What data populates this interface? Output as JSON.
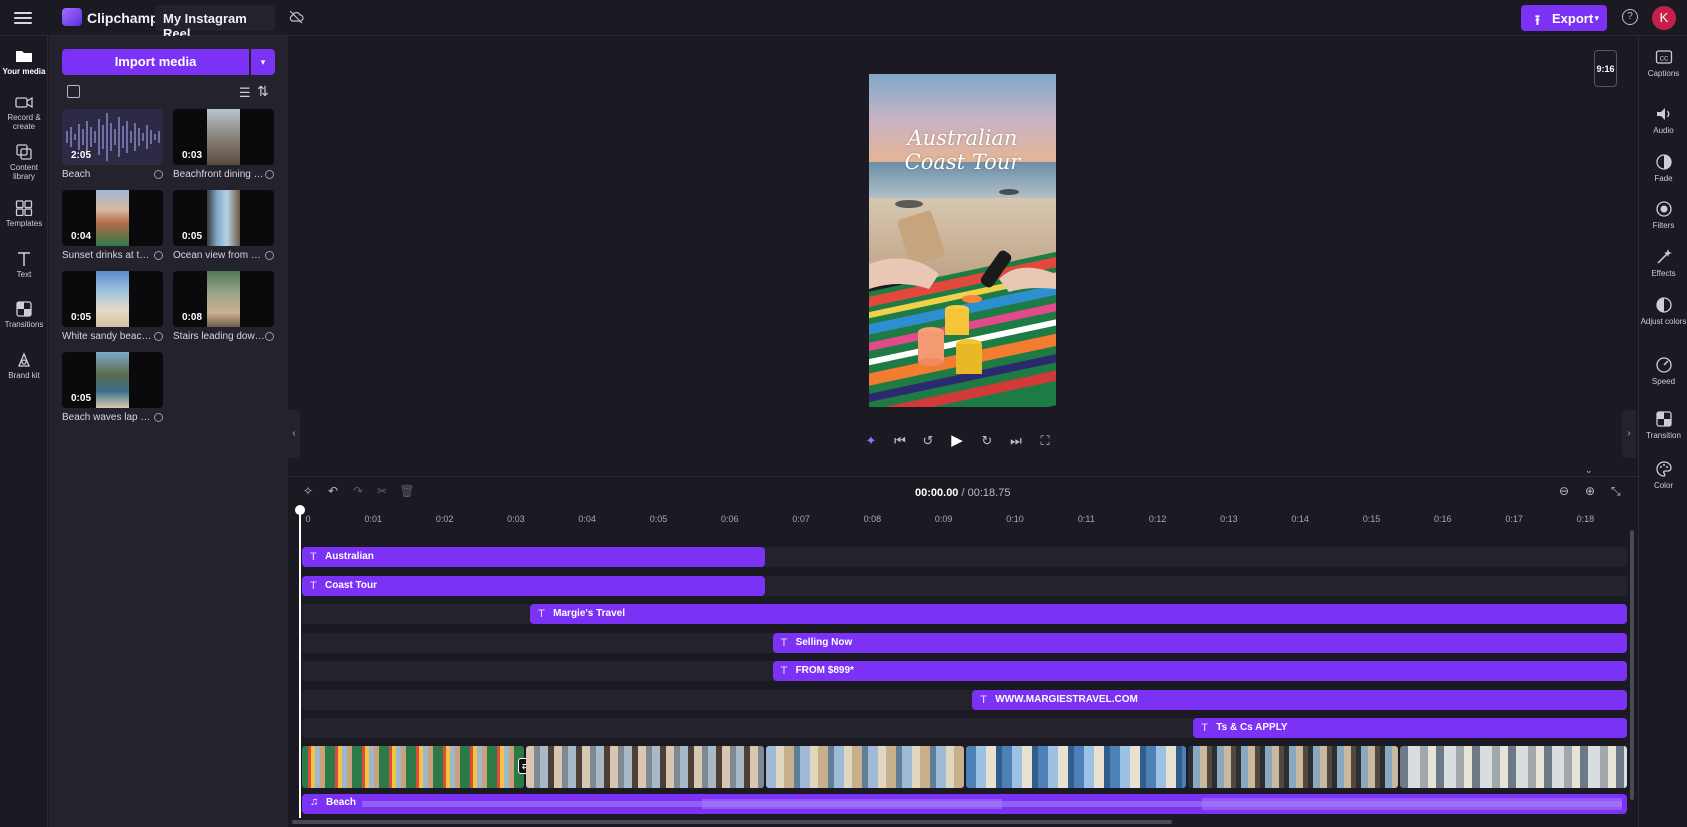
{
  "topbar": {
    "app_name": "Clipchamp",
    "project_name": "My Instagram Reel",
    "export_label": "Export",
    "avatar_initial": "K",
    "help_label": "?"
  },
  "left_rail": [
    {
      "label": "Your media",
      "icon": "folder-icon",
      "active": true
    },
    {
      "label": "Record & create",
      "icon": "camera-icon"
    },
    {
      "label": "Content library",
      "icon": "library-icon"
    },
    {
      "label": "Templates",
      "icon": "templates-icon"
    },
    {
      "label": "Text",
      "icon": "text-icon"
    },
    {
      "label": "Transitions",
      "icon": "transitions-icon"
    },
    {
      "label": "Brand kit",
      "icon": "brand-kit-icon"
    }
  ],
  "media_panel": {
    "import_label": "Import media",
    "items": [
      {
        "name": "Beach",
        "duration": "2:05",
        "kind": "audio"
      },
      {
        "name": "Beachfront dining a...",
        "duration": "0:03",
        "kind": "video"
      },
      {
        "name": "Sunset drinks at the...",
        "duration": "0:04",
        "kind": "video"
      },
      {
        "name": "Ocean view from wi...",
        "duration": "0:05",
        "kind": "video"
      },
      {
        "name": "White sandy beach ...",
        "duration": "0:05",
        "kind": "video"
      },
      {
        "name": "Stairs leading down...",
        "duration": "0:08",
        "kind": "video"
      },
      {
        "name": "Beach waves lap ov...",
        "duration": "0:05",
        "kind": "video"
      }
    ]
  },
  "preview": {
    "overlay_line1": "Australian",
    "overlay_line2": "Coast Tour",
    "aspect_ratio": "9:16"
  },
  "right_rail": [
    {
      "label": "Captions",
      "icon": "captions-icon"
    },
    {
      "label": "Audio",
      "icon": "audio-icon"
    },
    {
      "label": "Fade",
      "icon": "fade-icon"
    },
    {
      "label": "Filters",
      "icon": "filters-icon"
    },
    {
      "label": "Effects",
      "icon": "effects-icon"
    },
    {
      "label": "Adjust colors",
      "icon": "adjust-colors-icon"
    },
    {
      "label": "Speed",
      "icon": "speed-icon"
    },
    {
      "label": "Transition",
      "icon": "transition-icon"
    },
    {
      "label": "Color",
      "icon": "color-icon"
    }
  ],
  "timeline": {
    "current_time": "00:00.00",
    "total_time": "/ 00:18.75",
    "ruler_ticks": [
      "0",
      "0:01",
      "0:02",
      "0:03",
      "0:04",
      "0:05",
      "0:06",
      "0:07",
      "0:08",
      "0:09",
      "0:10",
      "0:11",
      "0:12",
      "0:13",
      "0:14",
      "0:15",
      "0:16",
      "0:17",
      "0:18"
    ],
    "text_clips": [
      {
        "label": "Australian",
        "start": 0.0,
        "end": 6.5
      },
      {
        "label": "Coast Tour",
        "start": 0.0,
        "end": 6.5
      },
      {
        "label": "Margie's Travel",
        "start": 3.2,
        "end": 18.75
      },
      {
        "label": "Selling Now",
        "start": 6.6,
        "end": 18.75
      },
      {
        "label": "FROM $899*",
        "start": 6.6,
        "end": 18.75
      },
      {
        "label": "WWW.MARGIESTRAVEL.COM",
        "start": 9.4,
        "end": 18.75
      },
      {
        "label": "Ts & Cs APPLY",
        "start": 12.5,
        "end": 18.75
      }
    ],
    "audio_clip_label": "Beach"
  },
  "colors": {
    "accent": "#7b32f5",
    "background": "#1b1a23",
    "panel": "#23222d",
    "avatar": "#c4204a"
  }
}
